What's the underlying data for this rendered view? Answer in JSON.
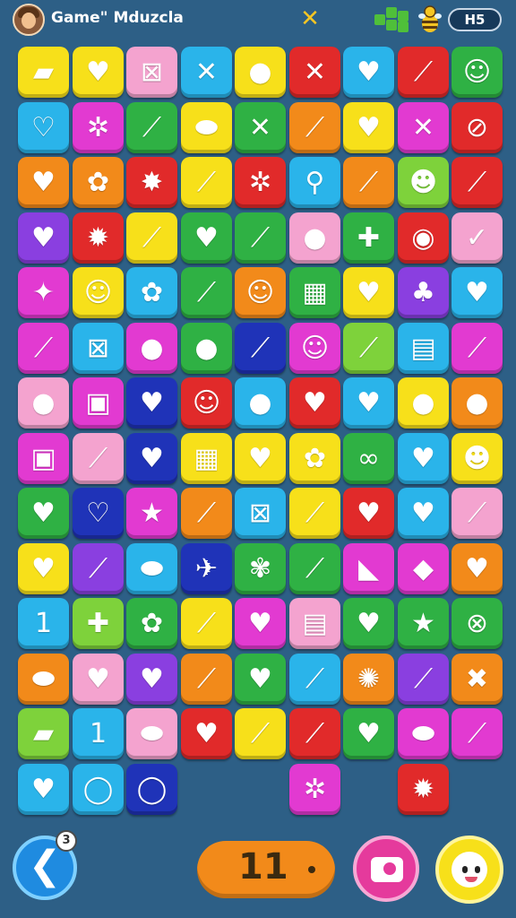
{
  "header": {
    "title": "Game\" Mduzcla",
    "close_symbol": "✕",
    "level_label": "H5"
  },
  "icons": {
    "avatar": "player-avatar",
    "close": "close-icon",
    "blocks": "green-blocks-icon",
    "bee": "bee-icon"
  },
  "footer": {
    "back_symbol": "❮",
    "back_badge": "3",
    "moves_count": "11",
    "radio_icon": "radio-icon",
    "mascot_icon": "mascot-icon"
  },
  "colors": {
    "background": "#2d5f86",
    "yellow": "#f7e01a",
    "green": "#2fb144",
    "pink": "#f4a3cf",
    "cyan": "#2ab4ea",
    "red": "#e12a2a",
    "orange": "#f28a1a",
    "purple": "#8a3fe0",
    "magenta": "#e23ad1",
    "navy": "#1f33b8",
    "lightgreen": "#7ed23b"
  },
  "board": {
    "rows": [
      [
        {
          "c": "yellow",
          "g": "▰"
        },
        {
          "c": "yellow",
          "g": "♥"
        },
        {
          "c": "pink",
          "g": "⊠"
        },
        {
          "c": "cyan",
          "g": "✕"
        },
        {
          "c": "yellow",
          "g": "●"
        },
        {
          "c": "red",
          "g": "✕"
        },
        {
          "c": "cyan",
          "g": "♥"
        },
        {
          "c": "red",
          "g": "⟋"
        },
        {
          "c": "green",
          "g": "☺"
        }
      ],
      [
        {
          "c": "cyan",
          "g": "♡"
        },
        {
          "c": "magenta",
          "g": "✲"
        },
        {
          "c": "green",
          "g": "⟋"
        },
        {
          "c": "yellow",
          "g": "⬬"
        },
        {
          "c": "green",
          "g": "✕"
        },
        {
          "c": "orange",
          "g": "⟋"
        },
        {
          "c": "yellow",
          "g": "♥"
        },
        {
          "c": "magenta",
          "g": "✕"
        },
        {
          "c": "red",
          "g": "⊘"
        }
      ],
      [
        {
          "c": "orange",
          "g": "♥"
        },
        {
          "c": "orange",
          "g": "✿"
        },
        {
          "c": "red",
          "g": "✸"
        },
        {
          "c": "yellow",
          "g": "⟋"
        },
        {
          "c": "red",
          "g": "✲"
        },
        {
          "c": "cyan",
          "g": "⚲"
        },
        {
          "c": "orange",
          "g": "⟋"
        },
        {
          "c": "lightgreen",
          "g": "☻"
        },
        {
          "c": "red",
          "g": "⟋"
        }
      ],
      [
        {
          "c": "purple",
          "g": "♥"
        },
        {
          "c": "red",
          "g": "✹"
        },
        {
          "c": "yellow",
          "g": "⟋"
        },
        {
          "c": "green",
          "g": "♥"
        },
        {
          "c": "green",
          "g": "⟋"
        },
        {
          "c": "pink",
          "g": "●"
        },
        {
          "c": "green",
          "g": "✚"
        },
        {
          "c": "red",
          "g": "◉"
        },
        {
          "c": "pink",
          "g": "✓"
        }
      ],
      [
        {
          "c": "magenta",
          "g": "✦"
        },
        {
          "c": "yellow",
          "g": "☺"
        },
        {
          "c": "cyan",
          "g": "✿"
        },
        {
          "c": "green",
          "g": "⟋"
        },
        {
          "c": "orange",
          "g": "☺"
        },
        {
          "c": "green",
          "g": "▦"
        },
        {
          "c": "yellow",
          "g": "♥"
        },
        {
          "c": "purple",
          "g": "♣"
        },
        {
          "c": "cyan",
          "g": "♥"
        }
      ],
      [
        {
          "c": "magenta",
          "g": "⟋"
        },
        {
          "c": "cyan",
          "g": "⊠"
        },
        {
          "c": "magenta",
          "g": "●"
        },
        {
          "c": "green",
          "g": "●"
        },
        {
          "c": "navy",
          "g": "⟋"
        },
        {
          "c": "magenta",
          "g": "☺"
        },
        {
          "c": "lightgreen",
          "g": "⟋"
        },
        {
          "c": "cyan",
          "g": "▤"
        },
        {
          "c": "magenta",
          "g": "⟋"
        }
      ],
      [
        {
          "c": "pink",
          "g": "●"
        },
        {
          "c": "magenta",
          "g": "▣"
        },
        {
          "c": "navy",
          "g": "♥"
        },
        {
          "c": "red",
          "g": "☺"
        },
        {
          "c": "cyan",
          "g": "●"
        },
        {
          "c": "red",
          "g": "♥"
        },
        {
          "c": "cyan",
          "g": "♥"
        },
        {
          "c": "yellow",
          "g": "●"
        },
        {
          "c": "orange",
          "g": "●"
        }
      ],
      [
        {
          "c": "magenta",
          "g": "▣"
        },
        {
          "c": "pink",
          "g": "⟋"
        },
        {
          "c": "navy",
          "g": "♥"
        },
        {
          "c": "yellow",
          "g": "▦"
        },
        {
          "c": "yellow",
          "g": "♥"
        },
        {
          "c": "yellow",
          "g": "✿"
        },
        {
          "c": "green",
          "g": "∞"
        },
        {
          "c": "cyan",
          "g": "♥"
        },
        {
          "c": "yellow",
          "g": "☻"
        }
      ],
      [
        {
          "c": "green",
          "g": "♥"
        },
        {
          "c": "navy",
          "g": "♡"
        },
        {
          "c": "magenta",
          "g": "★"
        },
        {
          "c": "orange",
          "g": "⟋"
        },
        {
          "c": "cyan",
          "g": "⊠"
        },
        {
          "c": "yellow",
          "g": "⟋"
        },
        {
          "c": "red",
          "g": "♥"
        },
        {
          "c": "cyan",
          "g": "♥"
        },
        {
          "c": "pink",
          "g": "⟋"
        }
      ],
      [
        {
          "c": "yellow",
          "g": "♥"
        },
        {
          "c": "purple",
          "g": "⟋"
        },
        {
          "c": "cyan",
          "g": "⬬"
        },
        {
          "c": "navy",
          "g": "✈"
        },
        {
          "c": "green",
          "g": "✾"
        },
        {
          "c": "green",
          "g": "⟋"
        },
        {
          "c": "magenta",
          "g": "◣"
        },
        {
          "c": "magenta",
          "g": "◆"
        },
        {
          "c": "orange",
          "g": "♥"
        }
      ],
      [
        {
          "c": "cyan",
          "g": "1"
        },
        {
          "c": "lightgreen",
          "g": "✚"
        },
        {
          "c": "green",
          "g": "✿"
        },
        {
          "c": "yellow",
          "g": "⟋"
        },
        {
          "c": "magenta",
          "g": "♥"
        },
        {
          "c": "pink",
          "g": "▤"
        },
        {
          "c": "green",
          "g": "♥"
        },
        {
          "c": "green",
          "g": "★"
        },
        {
          "c": "green",
          "g": "⊗"
        }
      ],
      [
        {
          "c": "orange",
          "g": "⬬"
        },
        {
          "c": "pink",
          "g": "♥"
        },
        {
          "c": "purple",
          "g": "♥"
        },
        {
          "c": "orange",
          "g": "⟋"
        },
        {
          "c": "green",
          "g": "♥"
        },
        {
          "c": "cyan",
          "g": "⟋"
        },
        {
          "c": "orange",
          "g": "✺"
        },
        {
          "c": "purple",
          "g": "⟋"
        },
        {
          "c": "orange",
          "g": "✖"
        }
      ],
      [
        {
          "c": "lightgreen",
          "g": "▰"
        },
        {
          "c": "cyan",
          "g": "1"
        },
        {
          "c": "pink",
          "g": "⬬"
        },
        {
          "c": "red",
          "g": "♥"
        },
        {
          "c": "yellow",
          "g": "⟋"
        },
        {
          "c": "red",
          "g": "⟋"
        },
        {
          "c": "green",
          "g": "♥"
        },
        {
          "c": "magenta",
          "g": "⬬"
        },
        {
          "c": "magenta",
          "g": "⟋"
        }
      ],
      [
        {
          "c": "cyan",
          "g": "♥"
        },
        {
          "c": "cyan",
          "g": "◯"
        },
        {
          "c": "navy",
          "g": "◯"
        },
        null,
        null,
        {
          "c": "magenta",
          "g": "✲"
        },
        null,
        {
          "c": "red",
          "g": "✹"
        },
        null
      ]
    ]
  }
}
